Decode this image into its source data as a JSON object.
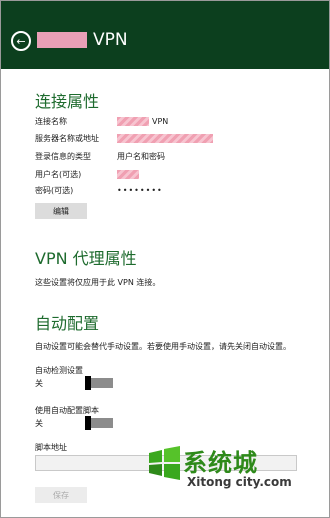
{
  "header": {
    "back_icon": "back-arrow-icon",
    "title_suffix": "VPN"
  },
  "connection_properties": {
    "title": "连接属性",
    "rows": [
      {
        "label": "连接名称",
        "value": "VPN"
      },
      {
        "label": "服务器名称或地址",
        "value": ""
      },
      {
        "label": "登录信息的类型",
        "value": "用户名和密码"
      },
      {
        "label": "用户名(可选)",
        "value": ""
      },
      {
        "label": "密码(可选)",
        "value": "••••••••"
      }
    ],
    "edit_button": "编辑"
  },
  "proxy": {
    "title": "VPN 代理属性",
    "description": "这些设置将仅应用于此 VPN 连接。"
  },
  "auto_config": {
    "title": "自动配置",
    "description": "自动设置可能会替代手动设置。若要使用手动设置，请先关闭自动设置。",
    "auto_detect": {
      "label": "自动检测设置",
      "state": "关"
    },
    "auto_script": {
      "label": "使用自动配置脚本",
      "state": "关"
    },
    "script_address": {
      "label": "脚本地址",
      "value": ""
    },
    "save_button": "保存"
  },
  "watermark": {
    "brand": "系统城",
    "url": "Xitong city.com"
  }
}
